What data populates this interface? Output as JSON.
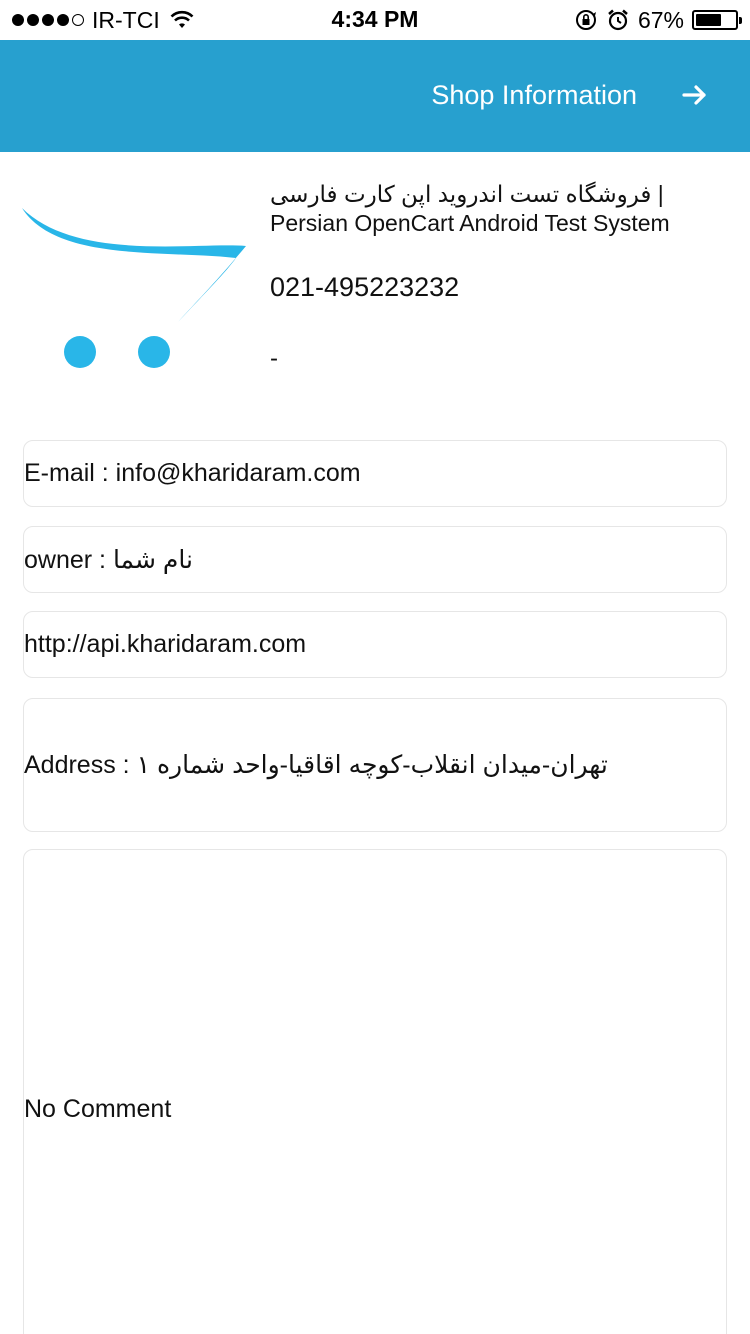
{
  "status_bar": {
    "carrier": "IR-TCI",
    "time": "4:34 PM",
    "battery": "67%",
    "battery_level": 0.67,
    "signal_bars_filled": 4,
    "signal_bars_total": 5
  },
  "header": {
    "title": "Shop Information",
    "background_color": "#27a0cf",
    "nav_icon": "arrow-right-icon"
  },
  "shop": {
    "name": "فروشگاه تست اندروید اپن کارت فارسی | Persian OpenCart Android Test System",
    "phone": "021-495223232",
    "fax": "-",
    "logo_icon": "opencart-cart-logo"
  },
  "details": {
    "email": "E-mail : info@kharidaram.com",
    "owner": "owner : نام شما",
    "website": "http://api.kharidaram.com",
    "address": "Address : تهران-میدان انقلاب-کوچه اقاقیا-واحد شماره ۱",
    "comment": "No Comment"
  },
  "colors": {
    "accent": "#27a0cf",
    "logo_blue": "#29b6e8"
  }
}
